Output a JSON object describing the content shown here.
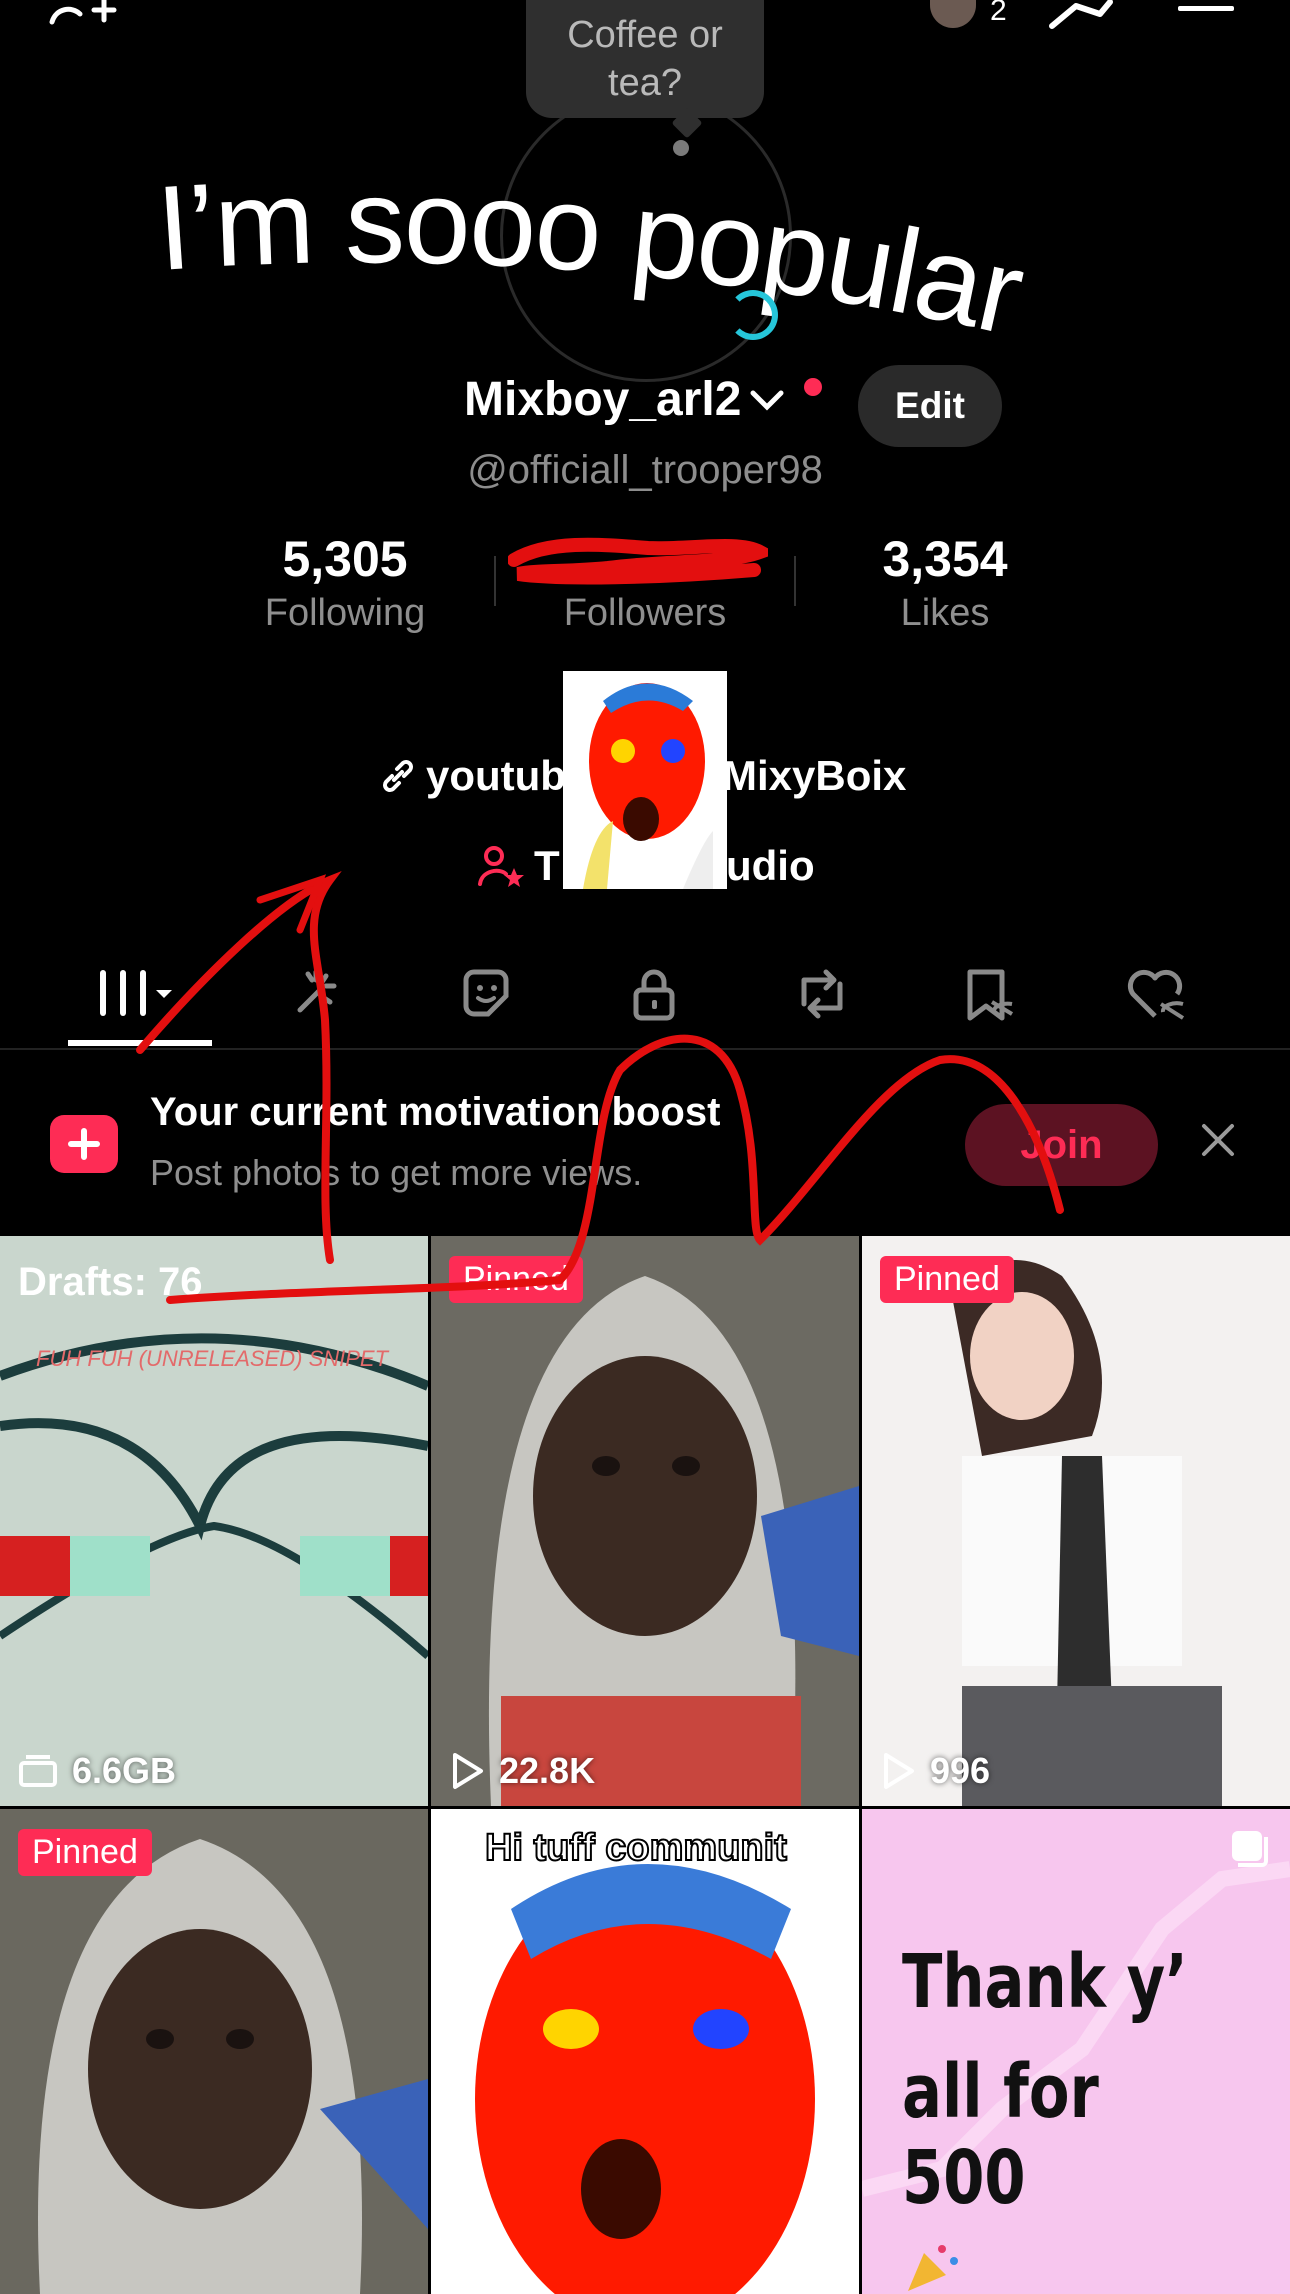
{
  "note": {
    "text": "Coffee or tea?"
  },
  "banner_text": "I’m sooo popular",
  "topbar": {
    "notification_count": "2"
  },
  "profile": {
    "name": "Mixboy_arl2",
    "edit_label": "Edit",
    "handle": "@officiall_trooper98",
    "stats": [
      {
        "value": "5,305",
        "label": "Following"
      },
      {
        "value": "",
        "label": "Followers"
      },
      {
        "value": "3,354",
        "label": "Likes"
      }
    ],
    "link_text": "youtube.com/@MixyBoix",
    "link_text_visible_left": "youtub",
    "link_text_visible_right": "MixyBoix",
    "studio_text_left": "T",
    "studio_text_right": "udio"
  },
  "tabs": [
    {
      "icon": "grid-icon"
    },
    {
      "icon": "sparkle-icon"
    },
    {
      "icon": "sticker-icon"
    },
    {
      "icon": "lock-icon"
    },
    {
      "icon": "repost-icon"
    },
    {
      "icon": "bookmark-icon"
    },
    {
      "icon": "heart-icon"
    }
  ],
  "promo": {
    "title": "Your current motivation boost",
    "subtitle": "Post photos to get more views.",
    "join_label": "Join"
  },
  "grid": [
    {
      "badge": "Drafts: 76",
      "caption": "FUH FUH (UNRELEASED) SNIPET",
      "meta": "6.6GB"
    },
    {
      "badge": "Pinned",
      "meta": "22.8K"
    },
    {
      "badge": "Pinned",
      "meta": "996"
    },
    {
      "badge": "Pinned"
    },
    {
      "caption": "Hi tuff communit"
    },
    {
      "caption_line1": "Thank y’",
      "caption_line2": "all for 500"
    }
  ],
  "colors": {
    "accent": "#fe2c55",
    "background": "#000000",
    "muted": "#8f8f8f"
  }
}
